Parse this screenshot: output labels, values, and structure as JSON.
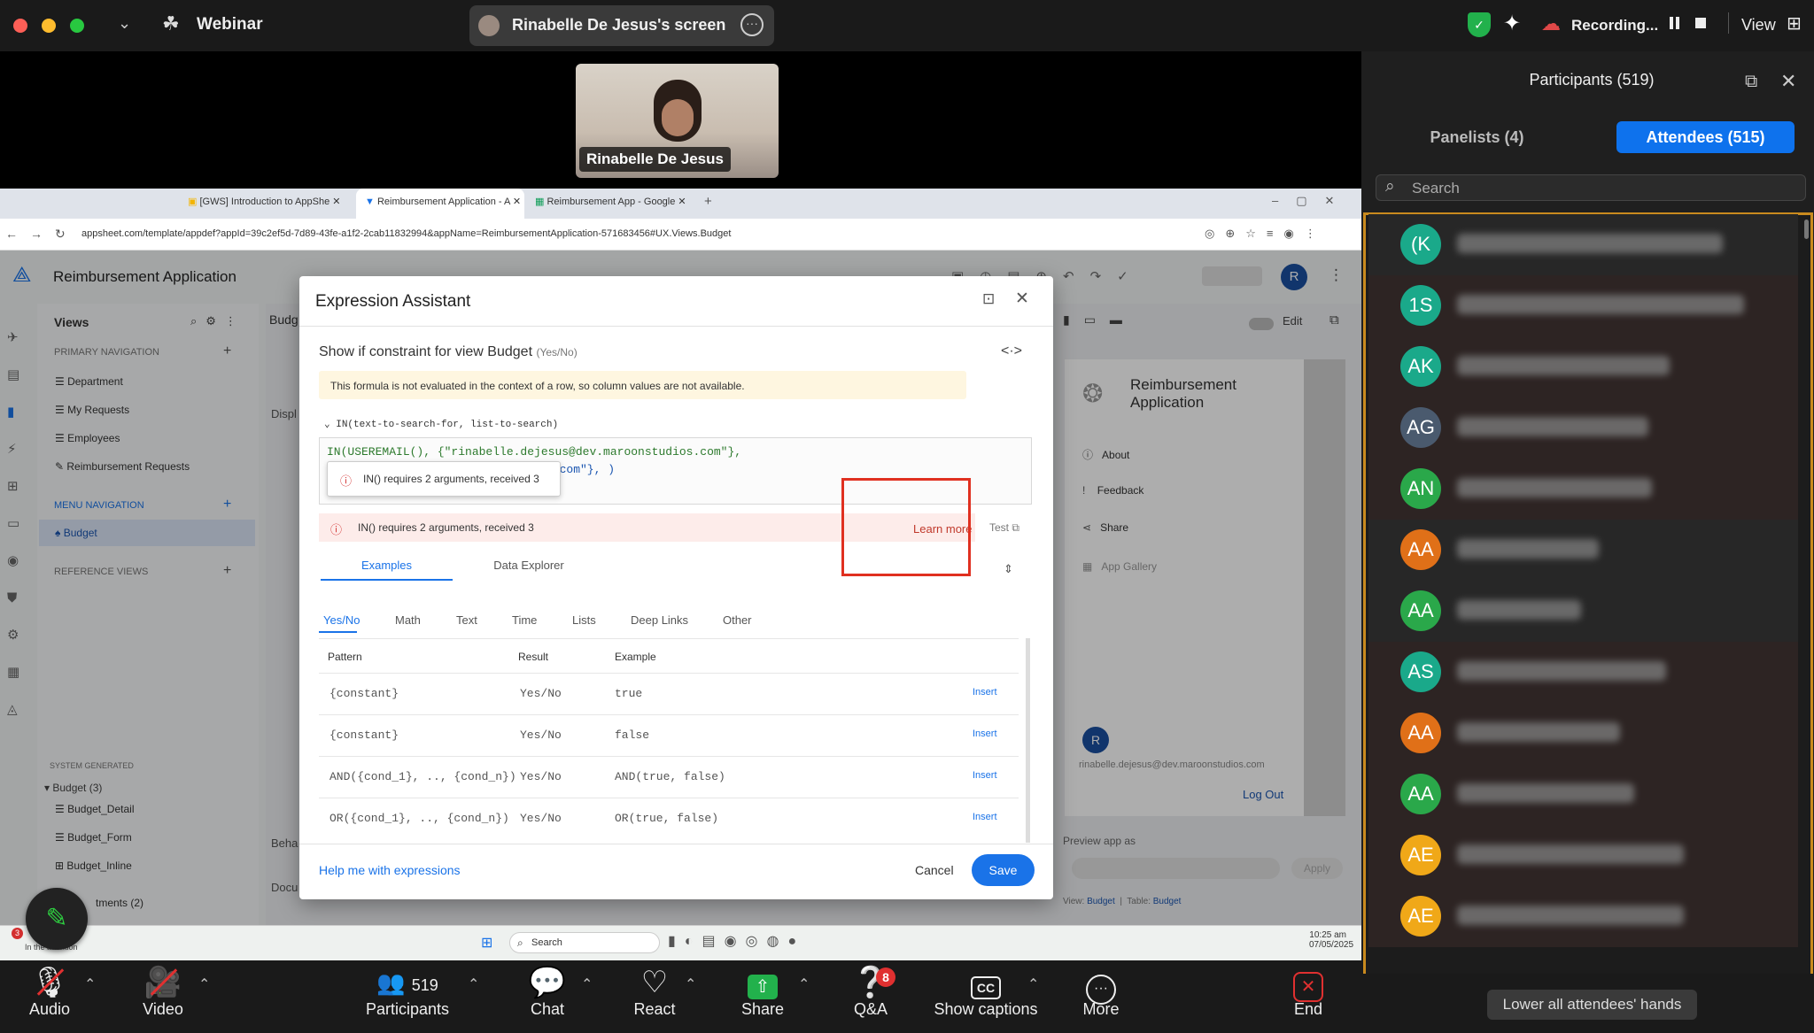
{
  "app": {
    "title": "Webinar"
  },
  "screen_share": {
    "label": "Rinabelle De Jesus's screen",
    "presenter_name": "Rinabelle De Jesus"
  },
  "status": {
    "recording": "Recording...",
    "view": "View"
  },
  "participants_panel": {
    "title": "Participants (519)",
    "tab_panelists": "Panelists (4)",
    "tab_attendees": "Attendees (515)",
    "search_placeholder": "Search",
    "lower_hands": "Lower all attendees' hands",
    "attendees": [
      {
        "initials": "(K",
        "color": "#1aa98a"
      },
      {
        "initials": "1S",
        "color": "#1aa98a"
      },
      {
        "initials": "AK",
        "color": "#1aa98a"
      },
      {
        "initials": "AG",
        "color": "#4a5a6e"
      },
      {
        "initials": "AN",
        "color": "#2aa84a"
      },
      {
        "initials": "AA",
        "color": "#e07018"
      },
      {
        "initials": "AA",
        "color": "#2aa84a"
      },
      {
        "initials": "AS",
        "color": "#1aa98a"
      },
      {
        "initials": "AA",
        "color": "#e07018"
      },
      {
        "initials": "AA",
        "color": "#2aa84a"
      },
      {
        "initials": "AE",
        "color": "#f0a818"
      },
      {
        "initials": "AE",
        "color": "#f0a818"
      }
    ]
  },
  "browser": {
    "tabs": [
      "[GWS] Introduction to AppShe",
      "Reimbursement Application - A",
      "Reimbursement App - Google"
    ],
    "url": "appsheet.com/template/appdef?appId=39c2ef5d-7d89-43fe-a1f2-2cab11832994&appName=ReimbursementApplication-571683456#UX.Views.Budget"
  },
  "appsheet": {
    "app_name": "Reimbursement Application",
    "views_label": "Views",
    "primary_nav": "PRIMARY NAVIGATION",
    "nav_items": [
      "Department",
      "My Requests",
      "Employees",
      "Reimbursement Requests"
    ],
    "menu_nav": "MENU NAVIGATION",
    "menu_items": [
      "Budget"
    ],
    "reference_views": "REFERENCE VIEWS",
    "system_generated": "SYSTEM GENERATED",
    "budget_group": "Budget (3)",
    "budget_items": [
      "Budget_Detail",
      "Budget_Form",
      "Budget_Inline"
    ],
    "attachments": "tments (2)",
    "budg": "Budg",
    "disp": "Displ",
    "beha": "Beha",
    "docu": "Docu",
    "edit": "Edit",
    "mini_app_title": "Reimbursement Application",
    "mini_menu": [
      "About",
      "Feedback",
      "Share",
      "App Gallery"
    ],
    "mini_email": "rinabelle.dejesus@dev.maroonstudios.com",
    "mini_logout": "Log Out",
    "preview_as": "Preview app as",
    "apply": "Apply",
    "view_label": "View:",
    "view_value": "Budget",
    "table_label": "Table:",
    "table_value": "Budget",
    "avatar": "R",
    "mini_avatar": "R"
  },
  "dialog": {
    "title": "Expression Assistant",
    "subtitle": "Show if constraint for view Budget",
    "subtitle_type": "(Yes/No)",
    "warning": "This formula is not evaluated in the context of a row, so column values are not available.",
    "signature": "IN(text-to-search-for, list-to-search)",
    "expr_line1": "IN(USEREMAIL(), {\"rinabelle.dejesus@dev.maroonstudios.com\"},",
    "expr_line2": "s.com\"}, )",
    "tooltip_error": "IN() requires 2 arguments, received 3",
    "error_text": "IN() requires 2 arguments, received 3",
    "learn_more": "Learn more",
    "test": "Test",
    "tab_examples": "Examples",
    "tab_data_explorer": "Data Explorer",
    "subtabs": [
      "Yes/No",
      "Math",
      "Text",
      "Time",
      "Lists",
      "Deep Links",
      "Other"
    ],
    "col_pattern": "Pattern",
    "col_result": "Result",
    "col_example": "Example",
    "rows": [
      {
        "pattern": "{constant}",
        "result": "Yes/No",
        "example": "true",
        "action": "Insert"
      },
      {
        "pattern": "{constant}",
        "result": "Yes/No",
        "example": "false",
        "action": "Insert"
      },
      {
        "pattern": "AND({cond_1}, .., {cond_n})",
        "result": "Yes/No",
        "example": "AND(true, false)",
        "action": "Insert"
      },
      {
        "pattern": "OR({cond_1}, .., {cond_n})",
        "result": "Yes/No",
        "example": "OR(true, false)",
        "action": "Insert"
      }
    ],
    "help": "Help me with expressions",
    "cancel": "Cancel",
    "save": "Save"
  },
  "taskbar": {
    "search": "Search",
    "time": "10:25 am",
    "date": "07/05/2025",
    "badge": "3",
    "notif": "In the attention"
  },
  "toolbar": {
    "audio": "Audio",
    "video": "Video",
    "participants": "Participants",
    "participants_count": "519",
    "chat": "Chat",
    "react": "React",
    "share": "Share",
    "qa": "Q&A",
    "qa_badge": "8",
    "captions": "Show captions",
    "more": "More",
    "end": "End"
  }
}
